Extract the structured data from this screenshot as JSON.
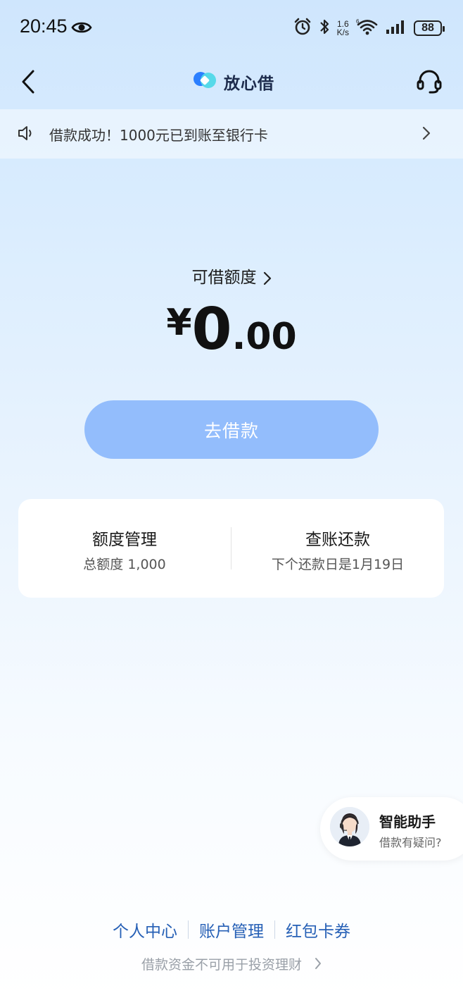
{
  "status_bar": {
    "time": "20:45",
    "net_speed_value": "1.6",
    "net_speed_unit": "K/s",
    "battery": "88",
    "icons": [
      "eye-icon",
      "alarm-icon",
      "bluetooth-icon",
      "wifi-icon",
      "signal-icon",
      "battery-icon"
    ]
  },
  "nav": {
    "brand_name": "放心借",
    "icons": [
      "back-arrow-icon",
      "brand-logo",
      "headset-icon"
    ]
  },
  "notice": {
    "text": "借款成功！1000元已到账至银行卡"
  },
  "credit": {
    "label": "可借额度",
    "currency": "¥",
    "amount_int": "0",
    "amount_dec": ".00"
  },
  "borrow_button": {
    "label": "去借款"
  },
  "card": {
    "left_title": "额度管理",
    "left_sub": "总额度 1,000",
    "right_title": "查账还款",
    "right_sub": "下个还款日是1月19日"
  },
  "assistant": {
    "title": "智能助手",
    "subtitle": "借款有疑问?"
  },
  "footer": {
    "links": [
      "个人中心",
      "账户管理",
      "红包卡券"
    ],
    "note": "借款资金不可用于投资理财"
  },
  "colors": {
    "accent": "#93bdfc",
    "link": "#2660b6",
    "brand_blue": "#2b7fff",
    "brand_cyan": "#4fd8e8"
  }
}
